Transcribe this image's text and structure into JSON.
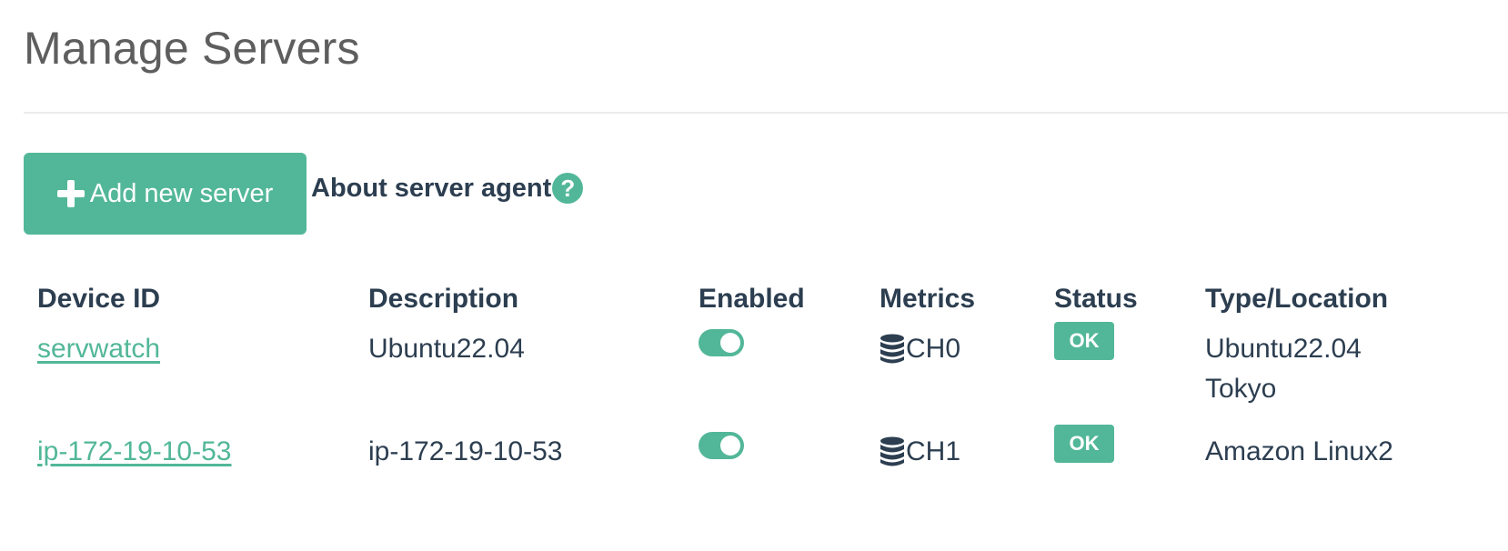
{
  "header": {
    "title": "Manage Servers"
  },
  "toolbar": {
    "add_label": "Add new server",
    "about_label": "About server agent",
    "help_glyph": "?"
  },
  "table": {
    "columns": [
      "Device ID",
      "Description",
      "Enabled",
      "Metrics",
      "Status",
      "Type/Location"
    ],
    "rows": [
      {
        "device_id": "servwatch",
        "description": "Ubuntu22.04",
        "enabled": true,
        "metrics": "CH0",
        "status": "OK",
        "type": "Ubuntu22.04",
        "location": "Tokyo"
      },
      {
        "device_id": "ip-172-19-10-53",
        "description": "ip-172-19-10-53",
        "enabled": true,
        "metrics": "CH1",
        "status": "OK",
        "type": "Amazon Linux2",
        "location": ""
      }
    ]
  },
  "icons": {
    "add": "plus-icon",
    "help": "question-circle-icon",
    "metrics": "database-icon"
  },
  "colors": {
    "accent": "#52b798",
    "text": "#2c3e50",
    "title": "#5e5e5e"
  }
}
